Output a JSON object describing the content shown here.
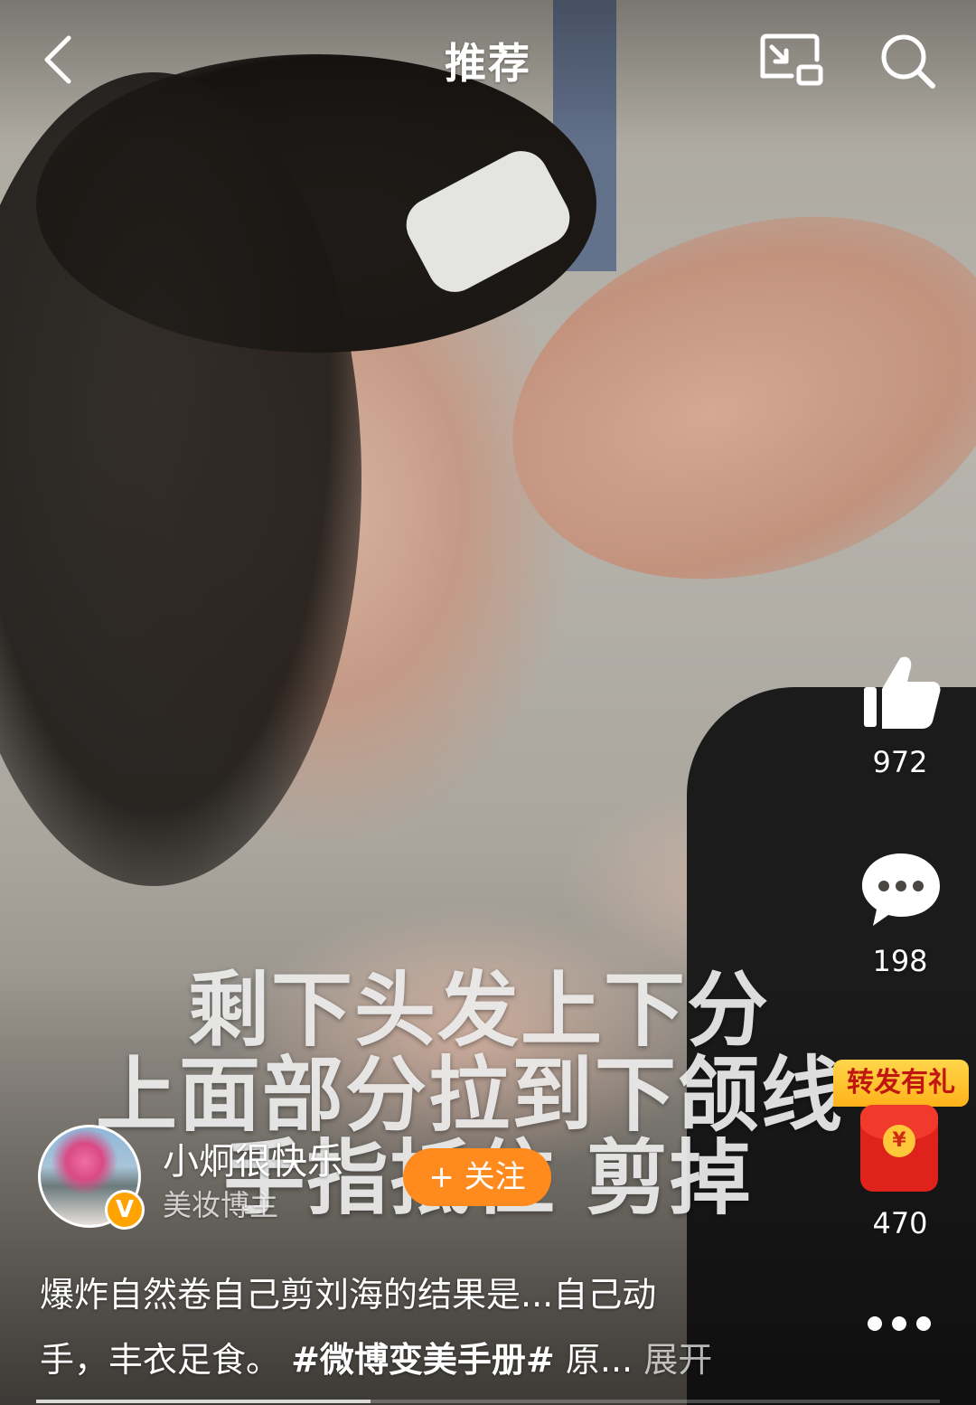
{
  "header": {
    "title": "推荐",
    "back_icon": "chevron-left-icon",
    "cast_icon": "screen-cast-icon",
    "search_icon": "search-icon"
  },
  "video": {
    "subtitles": [
      "剩下头发上下分",
      "上面部分拉到下颌线",
      "手指抵住 剪掉"
    ]
  },
  "actions": {
    "likes": "972",
    "comments": "198",
    "shares": "470",
    "share_badge": "转发有礼",
    "coin_symbol": "¥"
  },
  "author": {
    "name": "小炯很快乐",
    "tag": "美妆博主",
    "verified_mark": "V",
    "follow_label": "+ 关注"
  },
  "caption": {
    "line1": "爆炸自然卷自己剪刘海的结果是...自己动",
    "line2_prefix": "手，丰衣足食。 ",
    "hashtag": "#微博变美手册#",
    "line2_suffix": " 原...",
    "expand": "展开"
  },
  "playback": {
    "progress": 0.37
  },
  "colors": {
    "follow_button": "#ff8a1e",
    "verified_badge": "#ffa300",
    "red_envelope": "#e0221c"
  }
}
